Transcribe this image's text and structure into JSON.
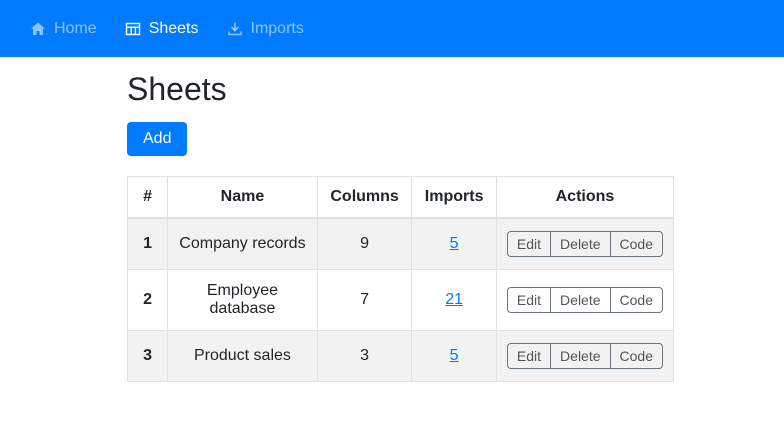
{
  "navbar": {
    "items": [
      {
        "label": "Home",
        "icon": "home-icon",
        "active": false
      },
      {
        "label": "Sheets",
        "icon": "table-icon",
        "active": true
      },
      {
        "label": "Imports",
        "icon": "download-icon",
        "active": false
      }
    ]
  },
  "page": {
    "title": "Sheets",
    "add_button": "Add"
  },
  "table": {
    "headers": [
      "#",
      "Name",
      "Columns",
      "Imports",
      "Actions"
    ],
    "action_labels": [
      "Edit",
      "Delete",
      "Code"
    ],
    "rows": [
      {
        "num": "1",
        "name": "Company records",
        "columns": "9",
        "imports": "5",
        "actions": [
          "Edit",
          "Delete",
          "Code"
        ]
      },
      {
        "num": "2",
        "name": "Employee database",
        "columns": "7",
        "imports": "21",
        "actions": [
          "Edit",
          "Delete",
          "Code"
        ]
      },
      {
        "num": "3",
        "name": "Product sales",
        "columns": "3",
        "imports": "5",
        "actions": [
          "Edit",
          "Delete",
          "Code"
        ]
      }
    ]
  },
  "colors": {
    "primary": "#007bff",
    "link": "#007bff",
    "stripe": "#f2f2f2",
    "table_border": "#dee2e6"
  }
}
